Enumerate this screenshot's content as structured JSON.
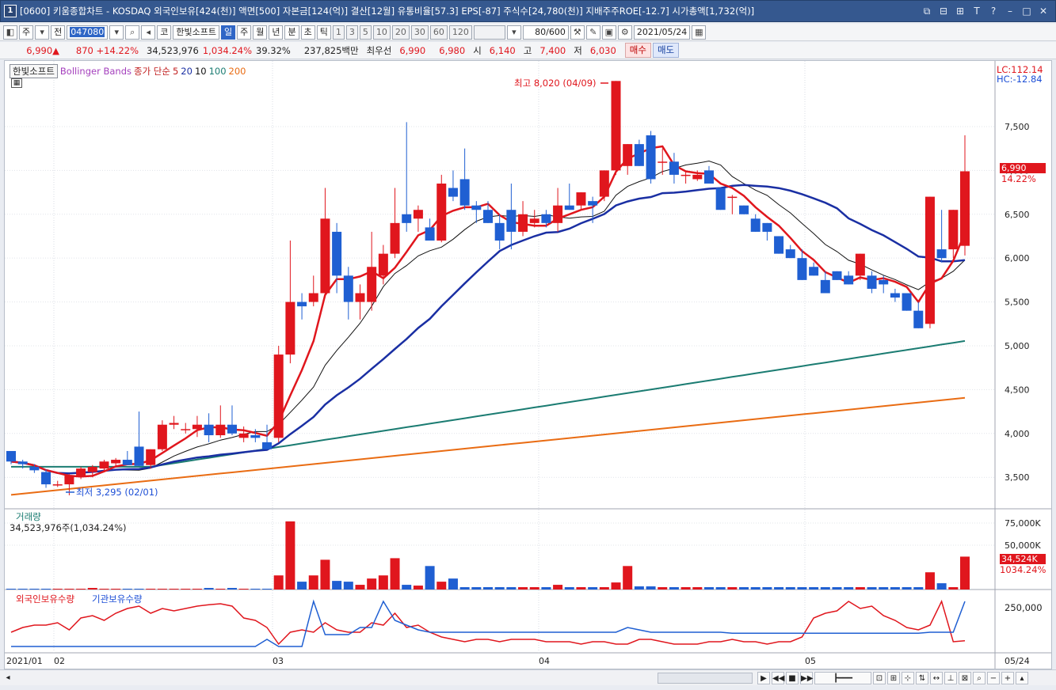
{
  "window": {
    "icon": "1",
    "title": "[0600] 키움종합차트 - KOSDAQ 외국인보유[424(천)] 액면[500] 자본금[124(억)] 결산[12월] 유통비율[57.3] EPS[-87] 주식수[24,780(천)] 지배주주ROE[-12.7] 시가총액[1,732(억)]",
    "controls": [
      "⧉",
      "⊟",
      "⊞",
      "T",
      "?",
      "–",
      "□",
      "✕"
    ]
  },
  "toolbar": {
    "period_main": "주",
    "period_sub": "전",
    "date_input": "047080",
    "code_label": "코",
    "stock_name": "한빛소프트",
    "periods": [
      "일",
      "주",
      "월",
      "년",
      "분",
      "초",
      "틱"
    ],
    "active_period": "일",
    "intervals": [
      "1",
      "3",
      "5",
      "10",
      "20",
      "30",
      "60",
      "120"
    ],
    "count": "80/600",
    "date": "2021/05/24"
  },
  "quote": {
    "price": "6,990▲",
    "change": "870 +14.22%",
    "volume": "34,523,976",
    "volume_ratio": "1,034.24%",
    "turnover": "39.32%",
    "amount": "237,825백만",
    "best_label": "최우선",
    "ask": "6,990",
    "bid": "6,980",
    "open_label": "시",
    "open": "6,140",
    "high_label": "고",
    "high": "7,400",
    "low_label": "저",
    "low": "6,030",
    "buy_label": "매수",
    "sell_label": "매도"
  },
  "legend": {
    "stock": "한빛소프트",
    "bollinger": "Bollinger Bands",
    "ma_label": "종가 단순",
    "ma_periods": [
      "5",
      "20",
      "10",
      "100",
      "200"
    ]
  },
  "annotations": {
    "lc": "LC:112.14",
    "hc": "HC:-12.84",
    "high_note": "최고 8,020 (04/09)",
    "low_note": "최저 3,295 (02/01)",
    "price_tag": "6,990",
    "price_pct": "14.22%",
    "volume_title": "거래량",
    "volume_info": "34,523,976주(1,034.24%)",
    "volume_tag": "34,524K",
    "volume_pct": "1034.24%",
    "holdings_title_1": "외국인보유수량",
    "holdings_title_2": "기관보유수량",
    "holdings_axis": "250,000"
  },
  "colors": {
    "up": "#e0161d",
    "down": "#1f5fd2",
    "ma5": "#e0161d",
    "ma10": "#111111",
    "ma20": "#1a2fa3",
    "ma100": "#1b7c72",
    "ma200": "#e96c13"
  },
  "chart_data": {
    "type": "candlestick",
    "price_axis": [
      "7,500",
      "7,000",
      "6,500",
      "6,000",
      "5,500",
      "5,000",
      "4,500",
      "4,000",
      "3,500"
    ],
    "volume_axis": [
      "75,000K",
      "50,000K"
    ],
    "time_labels": [
      "2021/01",
      "02",
      "03",
      "04",
      "05",
      "05/24"
    ],
    "candles": [
      [
        3800,
        3800,
        3650,
        3680
      ],
      [
        3680,
        3700,
        3600,
        3650
      ],
      [
        3620,
        3650,
        3550,
        3580
      ],
      [
        3560,
        3590,
        3380,
        3420
      ],
      [
        3420,
        3460,
        3390,
        3420
      ],
      [
        3420,
        3540,
        3295,
        3520
      ],
      [
        3520,
        3620,
        3480,
        3600
      ],
      [
        3560,
        3640,
        3500,
        3620
      ],
      [
        3600,
        3700,
        3560,
        3680
      ],
      [
        3660,
        3720,
        3620,
        3700
      ],
      [
        3700,
        3800,
        3650,
        3640
      ],
      [
        3850,
        4250,
        3640,
        3630
      ],
      [
        3640,
        3800,
        3600,
        3820
      ],
      [
        3820,
        4150,
        3800,
        4100
      ],
      [
        4100,
        4200,
        4050,
        4120
      ],
      [
        4050,
        4120,
        4000,
        4050
      ],
      [
        4050,
        4200,
        3960,
        4100
      ],
      [
        4100,
        4230,
        3900,
        3980
      ],
      [
        3980,
        4320,
        3950,
        4100
      ],
      [
        4100,
        4320,
        3980,
        4000
      ],
      [
        3950,
        4080,
        3900,
        4000
      ],
      [
        3980,
        4050,
        3900,
        3950
      ],
      [
        3900,
        4100,
        3820,
        3820
      ],
      [
        3950,
        5000,
        3900,
        4900
      ],
      [
        4900,
        6200,
        4800,
        5500
      ],
      [
        5500,
        5600,
        5300,
        5450
      ],
      [
        5500,
        5800,
        5450,
        5600
      ],
      [
        5600,
        6800,
        5550,
        6450
      ],
      [
        6300,
        6400,
        5600,
        5800
      ],
      [
        5800,
        5900,
        5300,
        5500
      ],
      [
        5500,
        5700,
        5300,
        5600
      ],
      [
        5500,
        6300,
        5400,
        5900
      ],
      [
        5800,
        6150,
        5700,
        6050
      ],
      [
        6050,
        6800,
        6000,
        6400
      ],
      [
        6500,
        7550,
        6300,
        6400
      ],
      [
        6450,
        6600,
        6300,
        6550
      ],
      [
        6350,
        6450,
        6200,
        6200
      ],
      [
        6200,
        6950,
        6180,
        6850
      ],
      [
        6800,
        7000,
        6650,
        6700
      ],
      [
        6900,
        7250,
        6550,
        6600
      ],
      [
        6600,
        6650,
        6400,
        6550
      ],
      [
        6550,
        6650,
        6400,
        6400
      ],
      [
        6400,
        6500,
        6100,
        6200
      ],
      [
        6550,
        6850,
        6100,
        6300
      ],
      [
        6300,
        6650,
        6250,
        6500
      ],
      [
        6400,
        6550,
        6350,
        6450
      ],
      [
        6500,
        6550,
        6350,
        6400
      ],
      [
        6400,
        6800,
        6300,
        6600
      ],
      [
        6600,
        6850,
        6550,
        6550
      ],
      [
        6600,
        6750,
        6550,
        6750
      ],
      [
        6650,
        6700,
        6400,
        6600
      ],
      [
        6700,
        6900,
        6650,
        7000
      ],
      [
        7000,
        7600,
        6950,
        8020
      ],
      [
        7050,
        7150,
        6950,
        7300
      ],
      [
        7300,
        7350,
        7050,
        7050
      ],
      [
        7400,
        7450,
        6850,
        6900
      ],
      [
        7100,
        7250,
        6950,
        7100
      ],
      [
        7100,
        7200,
        6850,
        6950
      ],
      [
        6950,
        7000,
        6850,
        6950
      ],
      [
        6900,
        7000,
        6880,
        6950
      ],
      [
        7000,
        7050,
        6850,
        6850
      ],
      [
        6800,
        6800,
        6600,
        6550
      ],
      [
        6700,
        6720,
        6500,
        6700
      ],
      [
        6600,
        6600,
        6500,
        6500
      ],
      [
        6450,
        6500,
        6300,
        6300
      ],
      [
        6400,
        6400,
        6200,
        6300
      ],
      [
        6250,
        6250,
        6100,
        6050
      ],
      [
        6100,
        6150,
        6000,
        6000
      ],
      [
        6000,
        6100,
        5900,
        5750
      ],
      [
        5900,
        5950,
        5800,
        5800
      ],
      [
        5750,
        5850,
        5700,
        5600
      ],
      [
        5850,
        5850,
        5750,
        5750
      ],
      [
        5800,
        5850,
        5750,
        5700
      ],
      [
        5800,
        5850,
        5750,
        6050
      ],
      [
        5800,
        5850,
        5600,
        5650
      ],
      [
        5750,
        5800,
        5600,
        5700
      ],
      [
        5600,
        5650,
        5500,
        5550
      ],
      [
        5600,
        5600,
        5400,
        5400
      ],
      [
        5400,
        5500,
        5250,
        5200
      ],
      [
        5250,
        6050,
        5200,
        6700
      ],
      [
        6100,
        6550,
        5950,
        6000
      ],
      [
        6100,
        6200,
        6000,
        6550
      ],
      [
        6140,
        7400,
        6030,
        6990
      ]
    ]
  }
}
